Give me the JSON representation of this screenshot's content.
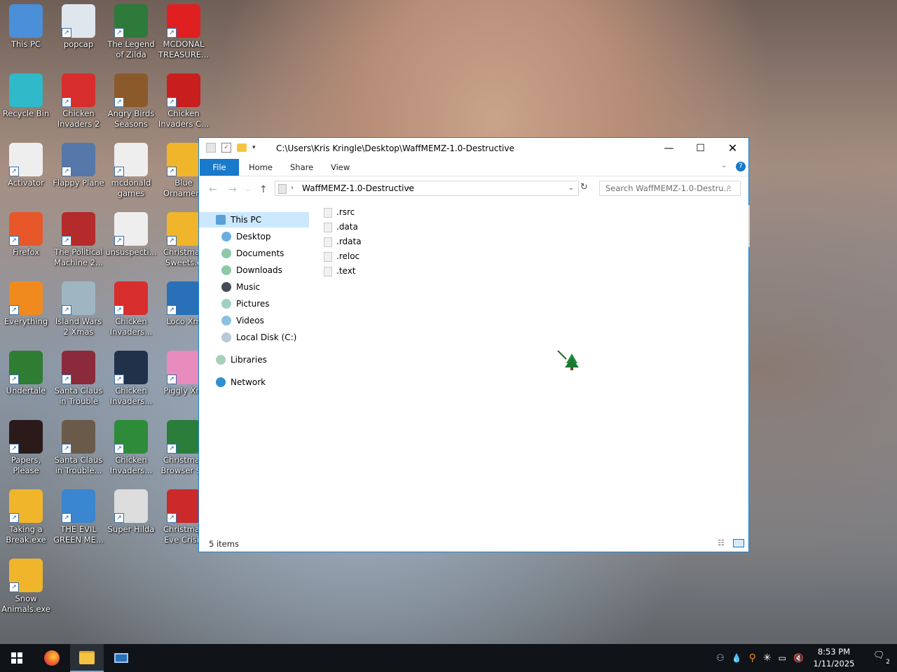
{
  "desktop": {
    "icons": [
      {
        "label": "This PC",
        "color": "#4a8fd8"
      },
      {
        "label": "popcap",
        "color": "#dfe6ee"
      },
      {
        "label": "The Legend of Zilda",
        "color": "#2d7a3b"
      },
      {
        "label": "MCDONAL TREASURE...",
        "color": "#e02020"
      },
      {
        "label": "Recycle Bin",
        "color": "#2fb9c9"
      },
      {
        "label": "Chicken Invaders 2",
        "color": "#d82d2d"
      },
      {
        "label": "Angry Birds Seasons",
        "color": "#8b5a2b"
      },
      {
        "label": "Chicken Invaders C...",
        "color": "#c81e1e"
      },
      {
        "label": "Activator",
        "color": "#eeeeee"
      },
      {
        "label": "Flappy Plane",
        "color": "#5577aa"
      },
      {
        "label": "mcdonald games",
        "color": "#eeeeee"
      },
      {
        "label": "Blue Ornament",
        "color": "#f1b52b"
      },
      {
        "label": "Firefox",
        "color": "#e8572a"
      },
      {
        "label": "The Political Machine 2...",
        "color": "#b52a2a"
      },
      {
        "label": "unsuspecti...",
        "color": "#eeeeee"
      },
      {
        "label": "Christmas Sweets.e",
        "color": "#f1b52b"
      },
      {
        "label": "Everything",
        "color": "#f08a1e"
      },
      {
        "label": "Island Wars 2 Xmas",
        "color": "#9fb6c2"
      },
      {
        "label": "Chicken Invaders...",
        "color": "#d82d2d"
      },
      {
        "label": "Loco Xm",
        "color": "#2a70b8"
      },
      {
        "label": "Undertale",
        "color": "#2e7d32"
      },
      {
        "label": "Santa Claus in Trouble",
        "color": "#8a2a3a"
      },
      {
        "label": "Chicken Invaders...",
        "color": "#22314a"
      },
      {
        "label": "Piggly Xm",
        "color": "#e88bbd"
      },
      {
        "label": "Papers, Please",
        "color": "#2a1a1a"
      },
      {
        "label": "Santa Claus in Trouble...",
        "color": "#6a5a4a"
      },
      {
        "label": "Chicken Invaders...",
        "color": "#2e8b3a"
      },
      {
        "label": "Christmas Browser 99",
        "color": "#2a7d3a"
      },
      {
        "label": "Taking a Break.exe",
        "color": "#f1b52b"
      },
      {
        "label": "THE EVIL GREEN ME...",
        "color": "#3a86d0"
      },
      {
        "label": "Super Hilda",
        "color": "#dddddd"
      },
      {
        "label": "Christmas Eve Crisis",
        "color": "#cc2a2a"
      },
      {
        "label": "Snow Animals.exe",
        "color": "#f1b52b"
      }
    ]
  },
  "window": {
    "title_path": "C:\\Users\\Kris Kringle\\Desktop\\WaffMEMZ-1.0-Destructive",
    "controls": {
      "minimize": "—",
      "maximize": "☐",
      "close": "✕"
    },
    "ribbon": {
      "file": "File",
      "home": "Home",
      "share": "Share",
      "view": "View"
    },
    "address": {
      "folder": "WaffMEMZ-1.0-Destructive"
    },
    "search_placeholder": "Search WaffMEMZ-1.0-Destru...",
    "nav": {
      "this_pc": "This PC",
      "desktop": "Desktop",
      "documents": "Documents",
      "downloads": "Downloads",
      "music": "Music",
      "pictures": "Pictures",
      "videos": "Videos",
      "local_disk": "Local Disk (C:)",
      "libraries": "Libraries",
      "network": "Network"
    },
    "files": [
      ".rsrc",
      ".data",
      ".rdata",
      ".reloc",
      ".text"
    ],
    "status": "5 items"
  },
  "taskbar": {
    "time": "8:53 PM",
    "date": "1/11/2025",
    "notifications": "2"
  },
  "colors": {
    "accent": "#1979ca",
    "taskbar": "#101318",
    "selection": "#cce8ff"
  }
}
